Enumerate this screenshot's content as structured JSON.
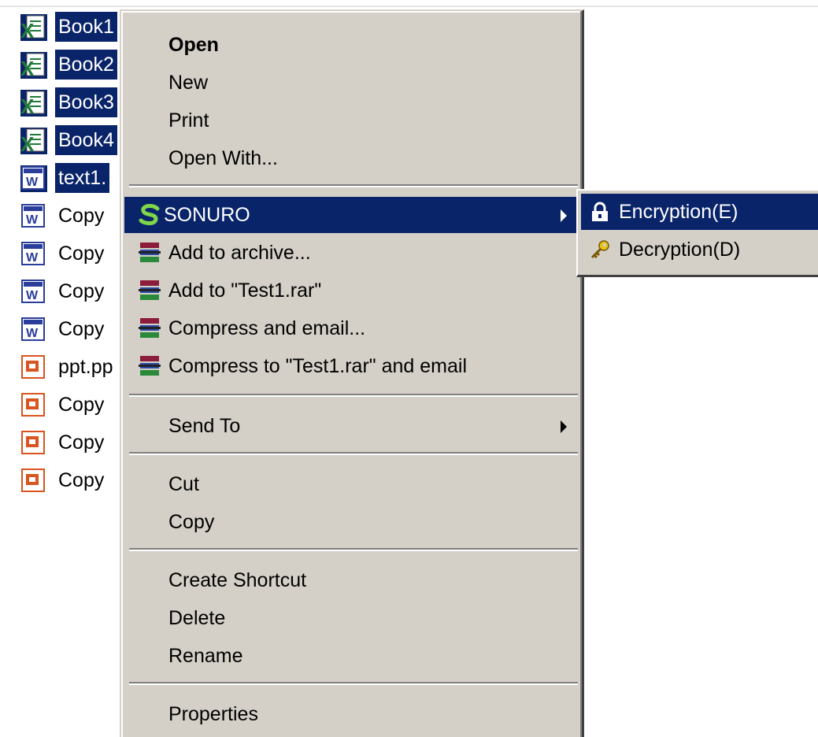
{
  "files": [
    {
      "name": "Book1",
      "type": "excel",
      "selected": true
    },
    {
      "name": "Book2",
      "type": "excel",
      "selected": true
    },
    {
      "name": "Book3",
      "type": "excel",
      "selected": true
    },
    {
      "name": "Book4",
      "type": "excel",
      "selected": true
    },
    {
      "name": "text1.",
      "type": "word",
      "selected": true
    },
    {
      "name": "Copy",
      "type": "word",
      "selected": false
    },
    {
      "name": "Copy",
      "type": "word",
      "selected": false
    },
    {
      "name": "Copy",
      "type": "word",
      "selected": false
    },
    {
      "name": "Copy",
      "type": "word",
      "selected": false
    },
    {
      "name": "ppt.pp",
      "type": "powerpoint",
      "selected": false
    },
    {
      "name": "Copy",
      "type": "powerpoint",
      "selected": false
    },
    {
      "name": "Copy",
      "type": "powerpoint",
      "selected": false
    },
    {
      "name": "Copy",
      "type": "powerpoint",
      "selected": false
    }
  ],
  "menu": {
    "open": "Open",
    "new": "New",
    "print": "Print",
    "open_with": "Open With...",
    "sonuro": "SONURO",
    "add_archive": "Add to archive...",
    "add_to_rar": "Add to \"Test1.rar\"",
    "compress_email": "Compress and email...",
    "compress_rar_email": "Compress to \"Test1.rar\" and email",
    "send_to": "Send To",
    "cut": "Cut",
    "copy": "Copy",
    "create_shortcut": "Create Shortcut",
    "delete": "Delete",
    "rename": "Rename",
    "properties": "Properties"
  },
  "submenu": {
    "encryption": "Encryption(E)",
    "decryption": "Decryption(D)"
  },
  "colors": {
    "selection": "#0a246a",
    "menu_bg": "#d4d0c8",
    "excel_icon": "#1f7a3a",
    "word_icon": "#2a3d9a",
    "powerpoint_icon": "#d9541e"
  }
}
